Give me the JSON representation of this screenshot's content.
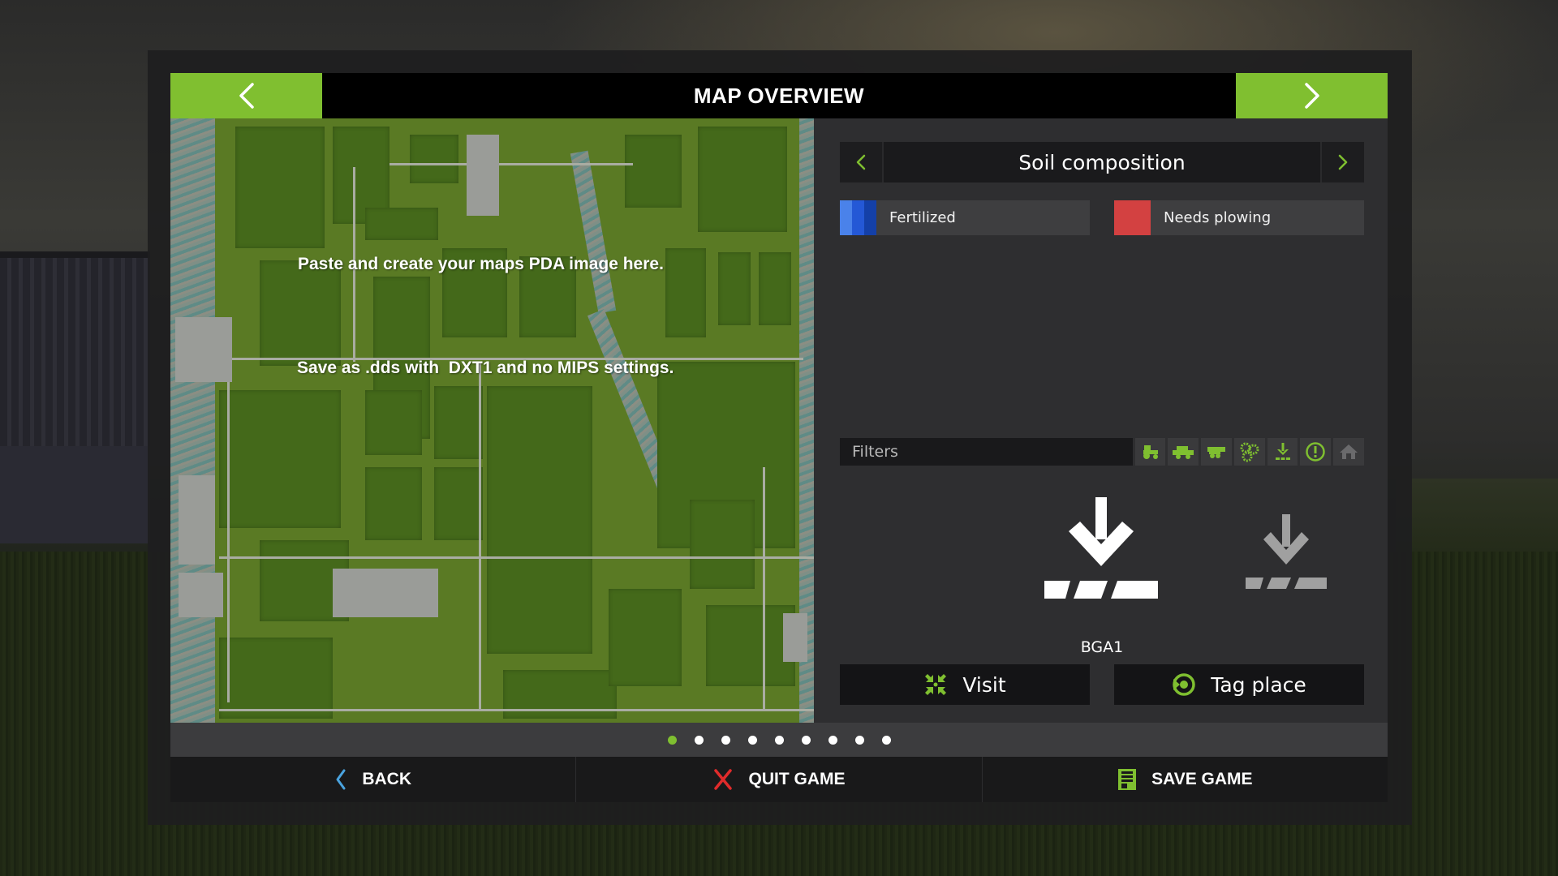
{
  "header": {
    "title": "MAP OVERVIEW",
    "prev_icon": "chevron-left-icon",
    "next_icon": "chevron-right-icon"
  },
  "map": {
    "instruction_line1": "Paste and create your maps PDA image here.",
    "instruction_line2": "Save as .dds with  DXT1 and no MIPS settings."
  },
  "overlay": {
    "title": "Soil composition",
    "legend": [
      {
        "label": "Fertilized",
        "colors": [
          "#4a82ea",
          "#2458d6",
          "#1440a8"
        ]
      },
      {
        "label": "Needs plowing",
        "colors": [
          "#d34141"
        ]
      }
    ]
  },
  "filters": {
    "label": "Filters",
    "icons": [
      {
        "name": "tractor-icon",
        "active": true
      },
      {
        "name": "harvester-icon",
        "active": true
      },
      {
        "name": "trailer-icon",
        "active": true
      },
      {
        "name": "gears-icon",
        "active": true
      },
      {
        "name": "unload-icon",
        "active": true
      },
      {
        "name": "exclamation-icon",
        "active": true
      },
      {
        "name": "house-icon",
        "active": false
      }
    ]
  },
  "hotspot": {
    "name": "BGA1",
    "icon": "unload-point-icon"
  },
  "actions": {
    "visit_label": "Visit",
    "tag_label": "Tag place"
  },
  "pager": {
    "total_pages": 9,
    "current_page": 1
  },
  "bottom_bar": {
    "back_label": "BACK",
    "quit_label": "QUIT GAME",
    "save_label": "SAVE GAME"
  },
  "colors": {
    "accent": "#7fbf30",
    "panel": "#2e2e30",
    "quit": "#e02b2b",
    "back": "#4aa3df"
  }
}
